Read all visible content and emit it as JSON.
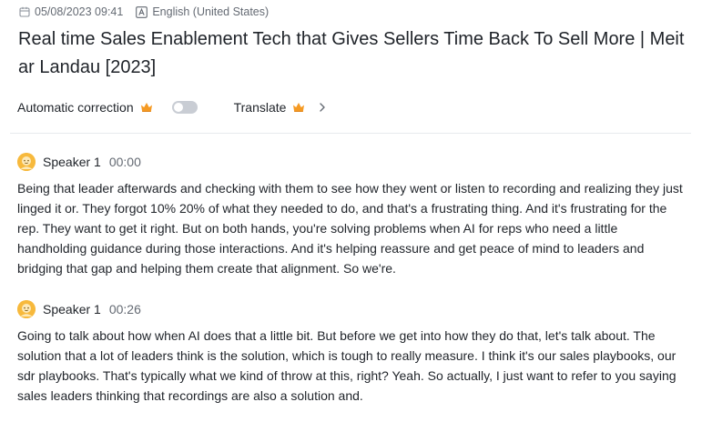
{
  "meta": {
    "datetime": "05/08/2023 09:41",
    "language": "English (United States)"
  },
  "title": "Real time Sales Enablement Tech that Gives Sellers Time Back To Sell More | Meitar Landau [2023]",
  "controls": {
    "auto_correction_label": "Automatic correction",
    "auto_correction_enabled": false,
    "translate_label": "Translate"
  },
  "transcript": [
    {
      "speaker": "Speaker 1",
      "time": "00:00",
      "text": "Being that leader afterwards and checking with them to see how they went or listen to recording and realizing they just linged it or. They forgot 10% 20% of what they needed to do, and that's a frustrating thing. And it's frustrating for the rep. They want to get it right. But on both hands, you're solving problems when AI for reps who need a little handholding guidance during those interactions. And it's helping reassure and get peace of mind to leaders and bridging that gap and helping them create that alignment. So we're."
    },
    {
      "speaker": "Speaker 1",
      "time": "00:26",
      "text": "Going to talk about how when AI does that a little bit. But before we get into how they do that, let's talk about. The solution that a lot of leaders think is the solution, which is tough to really measure. I think it's our sales playbooks, our sdr playbooks. That's typically what we kind of throw at this, right? Yeah. So actually, I just want to refer to you saying sales leaders thinking that recordings are also a solution and."
    }
  ],
  "colors": {
    "avatar": "#f7b93c",
    "crown": "#f59a23",
    "toggle_off": "#c9cdd4",
    "muted_text": "#646a73",
    "text": "#1f2329"
  }
}
